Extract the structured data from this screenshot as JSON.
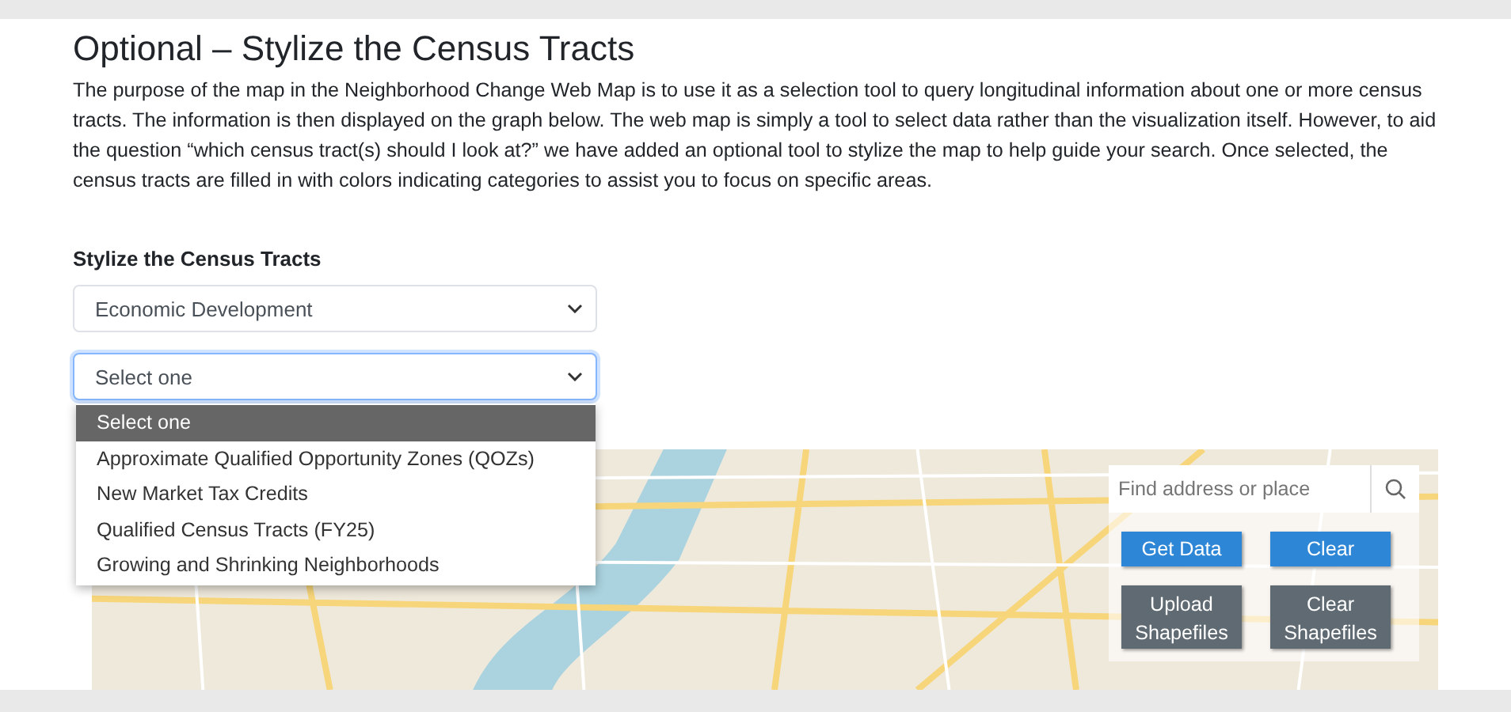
{
  "title": "Optional – Stylize the Census Tracts",
  "description": "The purpose of the map in the Neighborhood Change Web Map is to use it as a selection tool to query longitudinal information about one or more census tracts. The information is then displayed on the graph below. The web map is simply a tool to select data rather than the visualization itself. However, to aid the question “which census tract(s) should I look at?” we have added an optional tool to stylize the map to help guide your search. Once selected, the census tracts are filled in with colors indicating categories to assist you to focus on specific areas.",
  "stylize": {
    "label": "Stylize the Census Tracts",
    "category": {
      "value": "Economic Development"
    },
    "layer": {
      "value": "Select one",
      "focused": true,
      "expanded": true,
      "options": [
        {
          "label": "Select one",
          "selected": true
        },
        {
          "label": "Approximate Qualified Opportunity Zones (QOZs)",
          "selected": false
        },
        {
          "label": "New Market Tax Credits",
          "selected": false
        },
        {
          "label": "Qualified Census Tracts (FY25)",
          "selected": false
        },
        {
          "label": "Growing and Shrinking Neighborhoods",
          "selected": false
        }
      ]
    }
  },
  "map": {
    "search": {
      "placeholder": "Find address or place"
    },
    "buttons": [
      {
        "label": "Get Data",
        "kind": "primary"
      },
      {
        "label": "Clear",
        "kind": "primary"
      },
      {
        "label": "Upload Shapefiles",
        "kind": "secondary"
      },
      {
        "label": "Clear Shapefiles",
        "kind": "secondary"
      }
    ]
  }
}
